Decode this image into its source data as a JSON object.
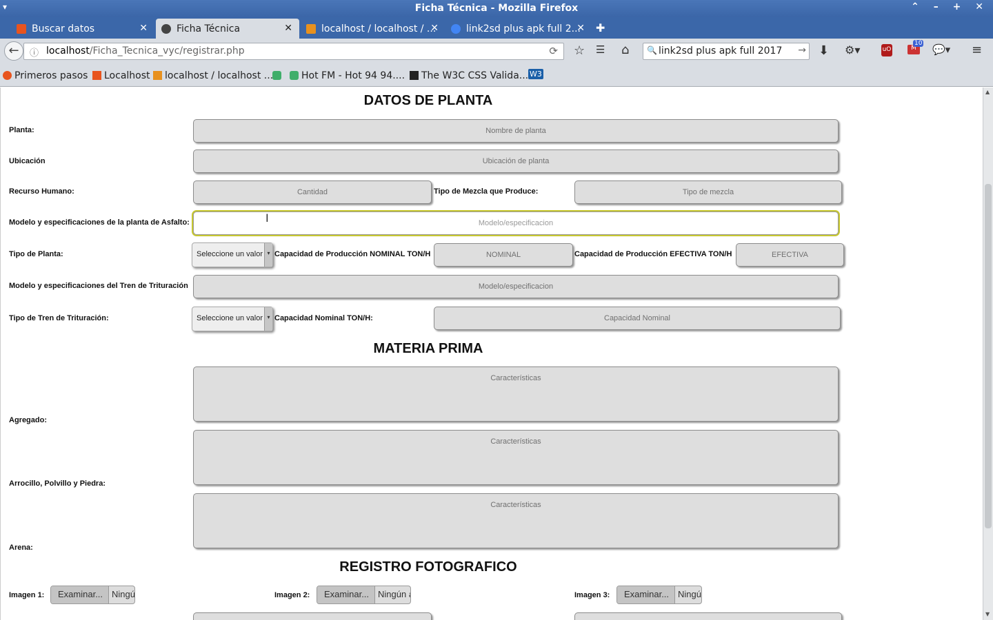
{
  "window": {
    "title": "Ficha Técnica - Mozilla Firefox",
    "menu_glyph": "▾",
    "controls": "⌃ – + ✕"
  },
  "tabs": [
    {
      "label": "Buscar datos",
      "close": "✕",
      "icon": "xampp-icon",
      "color": "#e8541e"
    },
    {
      "label": "Ficha Técnica",
      "close": "✕",
      "icon": "page-icon",
      "color": "#333"
    },
    {
      "label": "localhost / localhost / ...",
      "close": "✕",
      "icon": "phpmyadmin-icon",
      "color": "#e8911e"
    },
    {
      "label": "link2sd plus apk full 2...",
      "close": "✕",
      "icon": "google-icon",
      "color": "#4285f4"
    }
  ],
  "newtab": "✚",
  "nav": {
    "back": "←",
    "url_host": "localhost",
    "url_path": "/Ficha_Tecnica_vyc/registrar.php",
    "reload": "⟳",
    "search_value": "link2sd plus apk full 2017",
    "search_go": "→",
    "badge": "10"
  },
  "bookmarks": [
    {
      "label": "Primeros pasos",
      "color": "#e8541e"
    },
    {
      "label": "Localhost",
      "color": "#e8541e"
    },
    {
      "label": "localhost / localhost ...",
      "color": "#e8911e"
    },
    {
      "label": "",
      "color": "#3fae6a"
    },
    {
      "label": "Hot FM - Hot 94 94....",
      "color": "#3fae6a"
    },
    {
      "label": "The W3C CSS Valida...",
      "color": "#222"
    },
    {
      "label": "W3",
      "color": "#1a5fa8"
    }
  ],
  "form": {
    "section_planta": "DATOS DE PLANTA",
    "planta_label": "Planta:",
    "planta_ph": "Nombre de planta",
    "ubicacion_label": "Ubicación",
    "ubicacion_ph": "Ubicación de planta",
    "recurso_label": "Recurso Humano:",
    "recurso_ph": "Cantidad",
    "mezcla_label": "Tipo de Mezcla que Produce:",
    "mezcla_ph": "Tipo de mezcla",
    "modelo_asfalto_label": "Modelo y especificaciones de la planta de Asfalto:",
    "modelo_asfalto_ph": "Modelo/especificacion",
    "tipo_planta_label": "Tipo de Planta:",
    "select_value": "Seleccione un valor",
    "nominal_label": "Capacidad de Producción NOMINAL TON/H",
    "nominal_ph": "NOMINAL",
    "efectiva_label": "Capacidad de Producción EFECTIVA TON/H",
    "efectiva_ph": "EFECTIVA",
    "modelo_tren_label": "Modelo y especificaciones del Tren de Trituración",
    "modelo_tren_ph": "Modelo/especificacion",
    "tipo_tren_label": "Tipo de Tren de Trituración:",
    "cap_nominal_label": "Capacidad Nominal TON/H:",
    "cap_nominal_ph": "Capacidad Nominal",
    "section_materia": "MATERIA PRIMA",
    "agregado_label": "Agregado:",
    "arrocillo_label": "Arrocillo, Polvillo y Piedra:",
    "arena_label": "Arena:",
    "caracteristicas_ph": "Características",
    "section_foto": "REGISTRO FOTOGRAFICO",
    "imagen1_label": "Imagen 1:",
    "imagen2_label": "Imagen 2:",
    "imagen3_label": "Imagen 3:",
    "examinar": "Examinar...",
    "ningun1": "Ningú",
    "ningun2": "Ningún a",
    "ningun3": "Ningú"
  }
}
